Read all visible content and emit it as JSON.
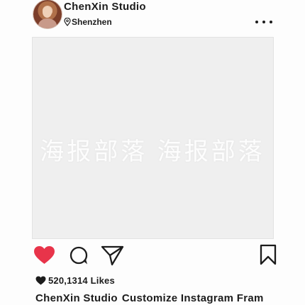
{
  "post": {
    "username": "ChenXin Studio",
    "location": "Shenzhen",
    "watermark_text": "海报部落    海报部落",
    "likes_text": "520,1314 Likes",
    "caption_user": "ChenXin Studio",
    "caption_text": "Customize Instagram Fram"
  },
  "icons": {
    "avatar": "avatar-photo",
    "location": "location-pin-icon",
    "more": "more-dots-icon",
    "like": "heart-icon",
    "comment": "comment-bubble-icon",
    "share": "paper-plane-icon",
    "save": "bookmark-icon",
    "likes": "heart-icon"
  },
  "colors": {
    "like_active": "#e8344a",
    "text": "#1c1c1c",
    "photo_bg": "#efefef"
  }
}
